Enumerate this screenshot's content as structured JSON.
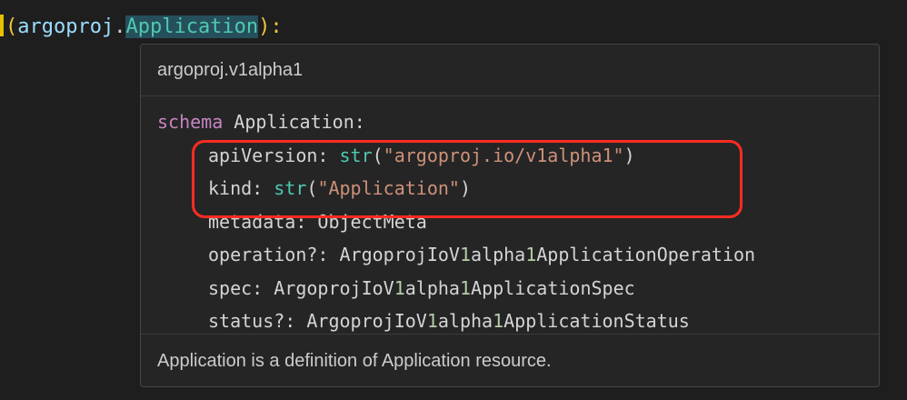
{
  "editor": {
    "open_paren": "(",
    "module": "argoproj",
    "dot": ".",
    "class_name": "Application",
    "close": "):"
  },
  "hover": {
    "header": "argoproj.v1alpha1",
    "schema_keyword": "schema",
    "schema_name": "Application:",
    "fields": [
      {
        "name": "apiVersion:",
        "fn": "str",
        "open": "(",
        "value": "\"argoproj.io/v1alpha1\"",
        "close": ")"
      },
      {
        "name": "kind:",
        "fn": "str",
        "open": "(",
        "value": "\"Application\"",
        "close": ")"
      },
      {
        "name": "metadata:",
        "type": "ObjectMeta"
      },
      {
        "name": "operation?:",
        "type_a": "ArgoprojIoV",
        "type_n1": "1",
        "type_b": "alpha",
        "type_n2": "1",
        "type_c": "ApplicationOperation"
      },
      {
        "name": "spec:",
        "type_a": "ArgoprojIoV",
        "type_n1": "1",
        "type_b": "alpha",
        "type_n2": "1",
        "type_c": "ApplicationSpec"
      },
      {
        "name": "status?:",
        "type_a": "ArgoprojIoV",
        "type_n1": "1",
        "type_b": "alpha",
        "type_n2": "1",
        "type_c": "ApplicationStatus"
      }
    ],
    "description": "Application is a definition of Application resource."
  },
  "colors": {
    "highlight_border": "#ff2d20",
    "keyword": "#c586c0",
    "function": "#4ec9b0",
    "string": "#ce9178",
    "number": "#b5cea8"
  }
}
